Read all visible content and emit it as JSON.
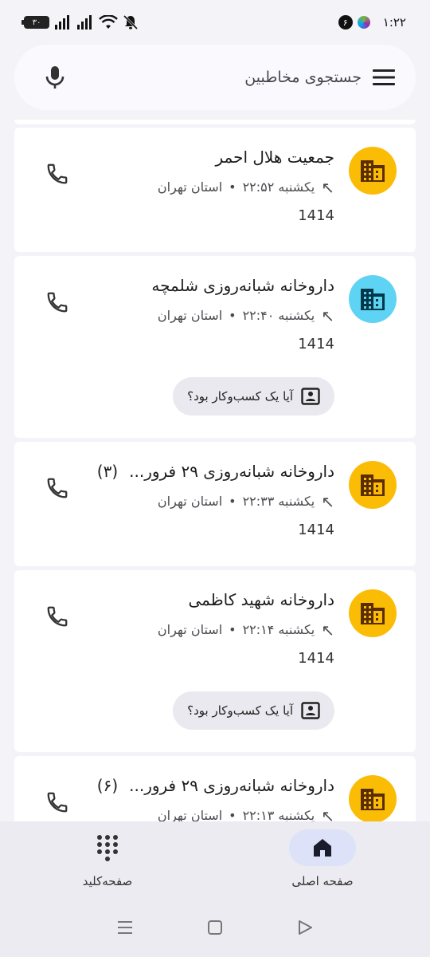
{
  "status_bar": {
    "time": "۱:۲۲",
    "notification_count": "۶",
    "battery": "۳۰"
  },
  "search": {
    "placeholder": "جستجوی مخاطبین"
  },
  "calls": [
    {
      "name": "جمعیت هلال احمر",
      "count": "",
      "time": "یکشنبه ۲۲:۵۲",
      "location": "استان تهران",
      "number": "1414",
      "avatar_color": "#fbbc05",
      "icon_color": "#5a2d00",
      "show_chip": false
    },
    {
      "name": "داروخانه شبانه‌روزی شلمچه",
      "count": "",
      "time": "یکشنبه ۲۲:۴۰",
      "location": "استان تهران",
      "number": "1414",
      "avatar_color": "#5fd3f3",
      "icon_color": "#00384a",
      "show_chip": true
    },
    {
      "name": "داروخانه شبانه‌روزی ۲۹ فرور...",
      "count": "(۳)",
      "time": "یکشنبه ۲۲:۳۳",
      "location": "استان تهران",
      "number": "1414",
      "avatar_color": "#fbbc05",
      "icon_color": "#5a2d00",
      "show_chip": false
    },
    {
      "name": "داروخانه شهید کاظمی",
      "count": "",
      "time": "یکشنبه ۲۲:۱۴",
      "location": "استان تهران",
      "number": "1414",
      "avatar_color": "#fbbc05",
      "icon_color": "#5a2d00",
      "show_chip": true
    },
    {
      "name": "داروخانه شبانه‌روزی ۲۹ فرور...",
      "count": "(۶)",
      "time": "یکشنبه ۲۲:۱۳",
      "location": "استان تهران",
      "number": "",
      "avatar_color": "#fbbc05",
      "icon_color": "#5a2d00",
      "show_chip": false
    }
  ],
  "chip_label": "آیا یک کسب‌وکار بود؟",
  "bottom_nav": {
    "home_label": "صفحه اصلی",
    "keypad_label": "صفحه‌کلید"
  }
}
